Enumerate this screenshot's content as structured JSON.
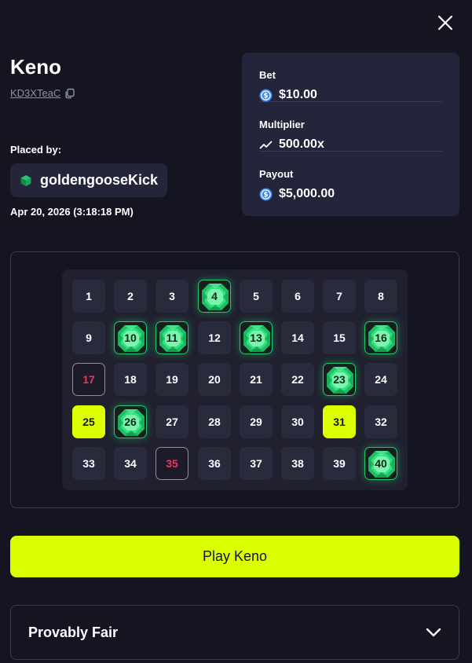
{
  "header": {
    "title": "Keno",
    "game_id": "KD3XTeaC"
  },
  "placed_by": {
    "label": "Placed by:",
    "username": "goldengooseKick",
    "timestamp": "Apr 20, 2026 (3:18:18 PM)"
  },
  "stats": {
    "bet_label": "Bet",
    "bet_value": "$10.00",
    "multiplier_label": "Multiplier",
    "multiplier_value": "500.00x",
    "payout_label": "Payout",
    "payout_value": "$5,000.00"
  },
  "board": {
    "tiles": [
      {
        "n": "1",
        "state": "normal"
      },
      {
        "n": "2",
        "state": "normal"
      },
      {
        "n": "3",
        "state": "normal"
      },
      {
        "n": "4",
        "state": "hit"
      },
      {
        "n": "5",
        "state": "normal"
      },
      {
        "n": "6",
        "state": "normal"
      },
      {
        "n": "7",
        "state": "normal"
      },
      {
        "n": "8",
        "state": "normal"
      },
      {
        "n": "9",
        "state": "normal"
      },
      {
        "n": "10",
        "state": "hit"
      },
      {
        "n": "11",
        "state": "hit"
      },
      {
        "n": "12",
        "state": "normal"
      },
      {
        "n": "13",
        "state": "hit"
      },
      {
        "n": "14",
        "state": "normal"
      },
      {
        "n": "15",
        "state": "normal"
      },
      {
        "n": "16",
        "state": "hit"
      },
      {
        "n": "17",
        "state": "miss"
      },
      {
        "n": "18",
        "state": "normal"
      },
      {
        "n": "19",
        "state": "normal"
      },
      {
        "n": "20",
        "state": "normal"
      },
      {
        "n": "21",
        "state": "normal"
      },
      {
        "n": "22",
        "state": "normal"
      },
      {
        "n": "23",
        "state": "hit"
      },
      {
        "n": "24",
        "state": "normal"
      },
      {
        "n": "25",
        "state": "picked"
      },
      {
        "n": "26",
        "state": "hit"
      },
      {
        "n": "27",
        "state": "normal"
      },
      {
        "n": "28",
        "state": "normal"
      },
      {
        "n": "29",
        "state": "normal"
      },
      {
        "n": "30",
        "state": "normal"
      },
      {
        "n": "31",
        "state": "picked"
      },
      {
        "n": "32",
        "state": "normal"
      },
      {
        "n": "33",
        "state": "normal"
      },
      {
        "n": "34",
        "state": "normal"
      },
      {
        "n": "35",
        "state": "miss"
      },
      {
        "n": "36",
        "state": "normal"
      },
      {
        "n": "37",
        "state": "normal"
      },
      {
        "n": "38",
        "state": "normal"
      },
      {
        "n": "39",
        "state": "normal"
      },
      {
        "n": "40",
        "state": "hit"
      }
    ]
  },
  "actions": {
    "play_label": "Play Keno"
  },
  "provably_fair": {
    "label": "Provably Fair"
  },
  "colors": {
    "accent": "#d9ff00",
    "hit_green": "#22c76b",
    "miss_red": "#f0365b",
    "background": "#151522"
  },
  "icons": {
    "close": "close-icon",
    "copy": "copy-icon",
    "user": "cube-icon",
    "currency": "coin-icon",
    "multiplier": "trend-icon",
    "gem": "emerald-gem-icon",
    "expand": "chevron-down-icon"
  }
}
